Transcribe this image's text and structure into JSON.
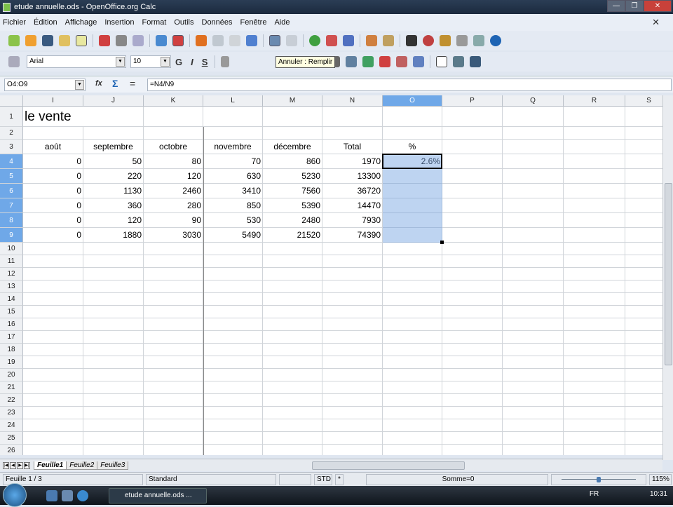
{
  "window": {
    "title": "etude annuelle.ods - OpenOffice.org Calc"
  },
  "menu": [
    "Fichier",
    "Édition",
    "Affichage",
    "Insertion",
    "Format",
    "Outils",
    "Données",
    "Fenêtre",
    "Aide"
  ],
  "toolbar": {
    "font_name": "Arial",
    "font_size": "10",
    "bold": "G",
    "italic": "I",
    "underline": "S",
    "tooltip": "Annuler : Remplir"
  },
  "formula": {
    "name_box": "O4:O9",
    "fx": "fx",
    "sum": "Σ",
    "equals": "=",
    "content": "=N4/N9"
  },
  "columns": [
    "I",
    "J",
    "K",
    "L",
    "M",
    "N",
    "O",
    "P",
    "Q",
    "R",
    "S"
  ],
  "selected_column": "O",
  "rows": [
    {
      "n": "1",
      "cells": [
        "le vente",
        "",
        "",
        "",
        "",
        "",
        "",
        "",
        "",
        "",
        ""
      ]
    },
    {
      "n": "2",
      "cells": [
        "",
        "",
        "",
        "",
        "",
        "",
        "",
        "",
        "",
        "",
        ""
      ]
    },
    {
      "n": "3",
      "cells": [
        "août",
        "septembre",
        "octobre",
        "novembre",
        "décembre",
        "Total",
        "%",
        "",
        "",
        "",
        ""
      ]
    },
    {
      "n": "4",
      "cells": [
        "0",
        "50",
        "80",
        "70",
        "860",
        "1970",
        "2.6%",
        "",
        "",
        "",
        ""
      ]
    },
    {
      "n": "5",
      "cells": [
        "0",
        "220",
        "120",
        "630",
        "5230",
        "13300",
        "",
        "",
        "",
        "",
        ""
      ]
    },
    {
      "n": "6",
      "cells": [
        "0",
        "1130",
        "2460",
        "3410",
        "7560",
        "36720",
        "",
        "",
        "",
        "",
        ""
      ]
    },
    {
      "n": "7",
      "cells": [
        "0",
        "360",
        "280",
        "850",
        "5390",
        "14470",
        "",
        "",
        "",
        "",
        ""
      ]
    },
    {
      "n": "8",
      "cells": [
        "0",
        "120",
        "90",
        "530",
        "2480",
        "7930",
        "",
        "",
        "",
        "",
        ""
      ]
    },
    {
      "n": "9",
      "cells": [
        "0",
        "1880",
        "3030",
        "5490",
        "21520",
        "74390",
        "",
        "",
        "",
        "",
        ""
      ]
    }
  ],
  "empty_rows": [
    "10",
    "11",
    "12",
    "13",
    "14",
    "15",
    "16",
    "17",
    "18",
    "19",
    "20",
    "21",
    "22",
    "23",
    "24",
    "25",
    "26"
  ],
  "sheets": [
    "Feuille1",
    "Feuille2",
    "Feuille3"
  ],
  "active_sheet": "Feuille1",
  "status": {
    "sheet": "Feuille 1 / 3",
    "style": "Standard",
    "mode": "STD",
    "modified": "*",
    "sum": "Somme=0",
    "zoom": "115%"
  },
  "taskbar": {
    "task": "etude annuelle.ods ...",
    "lang": "FR",
    "time": "10:31"
  },
  "colors": {
    "selection": "#6fa8e8",
    "accent": "#1e64b4"
  }
}
